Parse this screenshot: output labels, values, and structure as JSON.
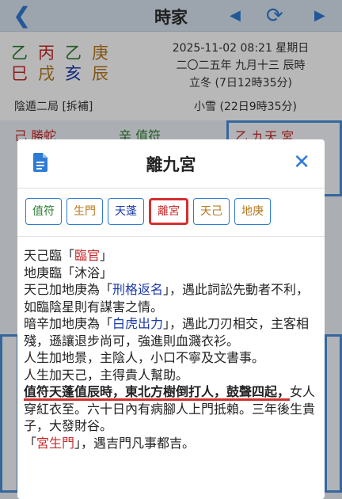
{
  "header": {
    "title": "時家",
    "back": "❮",
    "prev": "◀",
    "refresh": "⟳",
    "next": "▶"
  },
  "info": {
    "pillars_top": [
      "乙",
      "丙",
      "乙",
      "庚"
    ],
    "pillars_bottom": [
      "巳",
      "戌",
      "亥",
      "辰"
    ],
    "pillar_colors_top": [
      "#2e7d32",
      "#c62828",
      "#2e7d32",
      "#b7791f"
    ],
    "pillar_colors_bottom": [
      "#c62828",
      "#b7791f",
      "#1a3aa8",
      "#b7791f"
    ],
    "datetime": "2025-11-02 08:21 星期日",
    "lunar": "二〇二五年 九月十三 辰時",
    "jieqi1": "立冬 (7日12時35分)",
    "ju": "陰遁二局 [拆補]",
    "jieqi2": "小雪 (22日9時35分)"
  },
  "grid": {
    "cell_left_top": "己 勝蛇",
    "cell_mid_top": "辛 值符",
    "cell_right_top": "乙 九天 宮"
  },
  "modal": {
    "title": "離九宮",
    "close": "✕",
    "tabs": [
      {
        "label": "值符",
        "color": "#2e7d32",
        "selected": false
      },
      {
        "label": "生門",
        "color": "#b7791f",
        "selected": false
      },
      {
        "label": "天蓬",
        "color": "#1a3aa8",
        "selected": false
      },
      {
        "label": "離宮",
        "color": "#c62828",
        "selected": true
      },
      {
        "label": "天己",
        "color": "#b7791f",
        "selected": false
      },
      {
        "label": "地庚",
        "color": "#b7791f",
        "selected": false
      }
    ],
    "content": {
      "l1_a": "天己臨「",
      "l1_b": "臨官",
      "l1_c": "」",
      "l2": "地庚臨「沐浴」",
      "l3_a": "天己加地庚為「",
      "l3_b": "刑格返名",
      "l3_c": "」，遇此詞訟先動者不利，如臨陰星則有謀害之情。",
      "l4_a": "暗辛加地庚為「",
      "l4_b": "白虎出力",
      "l4_c": "」，遇此刀刃相交，主客相殘，遜讓退步尚可，強進則血濺衣衫。",
      "l5": "人生加地景，主陰人，小口不寧及文書事。",
      "l6": "人生加天己，主得貴人幫助。",
      "l7_strong": "值符天蓬值辰時，東北方樹倒打人，鼓聲四起，",
      "l7_rest": "女人穿紅衣至。六十日內有病腳人上門抵賴。三年後生貴子，大發財谷。",
      "l8_a": "「",
      "l8_b": "宮生門",
      "l8_c": "」，遇吉門凡事都吉。"
    }
  }
}
